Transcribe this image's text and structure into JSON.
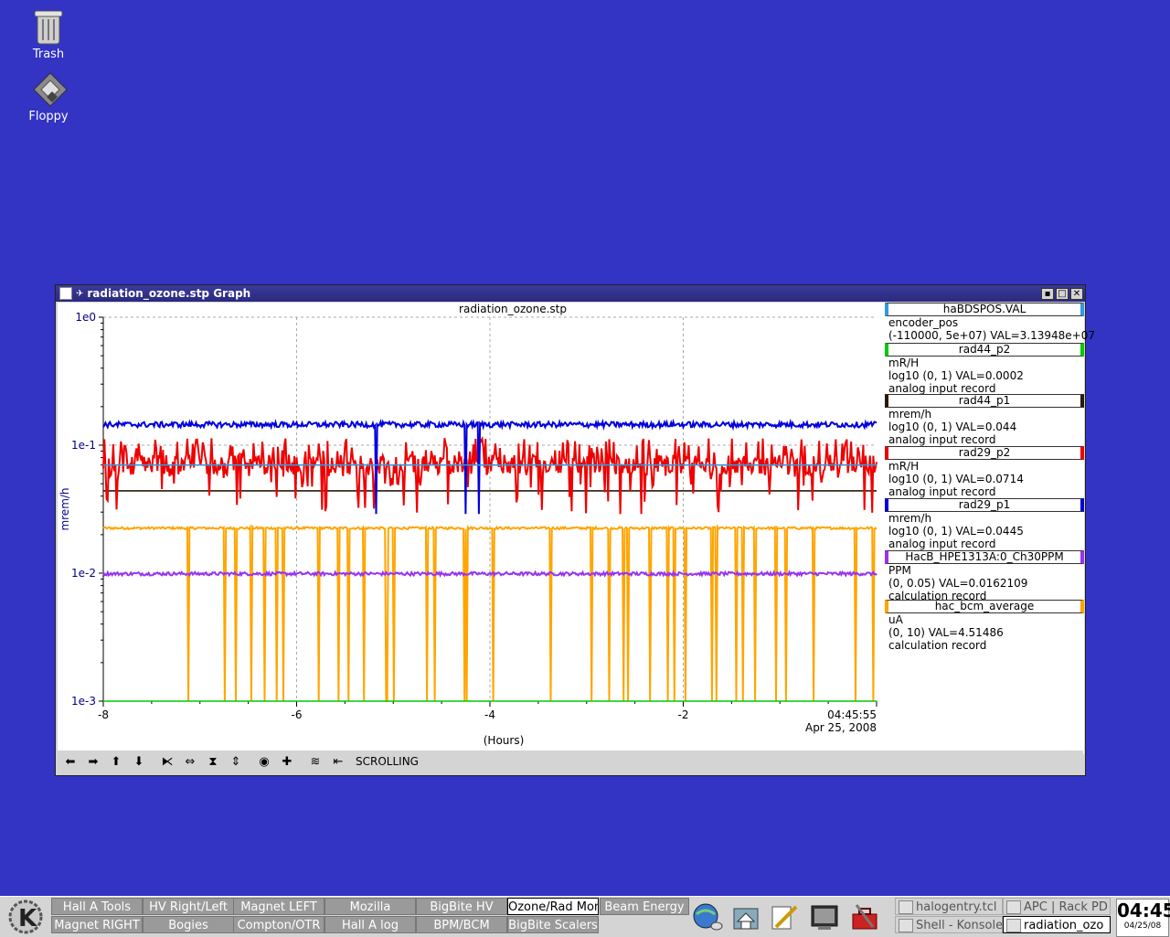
{
  "desktop": {
    "icons": [
      {
        "label": "Trash",
        "icon": "trash-icon"
      },
      {
        "label": "Floppy",
        "icon": "floppy-icon"
      }
    ]
  },
  "window": {
    "title": "radiation_ozone.stp Graph",
    "status": "SCROLLING"
  },
  "chart_data": {
    "type": "line",
    "title": "radiation_ozone.stp",
    "xlabel": "(Hours)",
    "ylabel": "mrem/h",
    "x_ticks": [
      "-8",
      "-6",
      "-4",
      "-2"
    ],
    "x_end_label": [
      "04:45:55",
      "Apr 25, 2008"
    ],
    "y_ticks": [
      "1e0",
      "1e-1",
      "1e-2",
      "1e-3"
    ],
    "y_scale": "log",
    "ylim": [
      0.001,
      1
    ],
    "xlim": [
      -8,
      0
    ],
    "grid": true,
    "series": [
      {
        "name": "haBDSPOS.VAL",
        "color": "#3399dd",
        "level": 0.07,
        "noise": 0.0,
        "dips": 0
      },
      {
        "name": "rad44_p2",
        "color": "#00cc00",
        "level": 0.001,
        "noise": 0.0,
        "dips": 0
      },
      {
        "name": "rad44_p1",
        "color": "#2a1a0a",
        "level": 0.044,
        "noise": 0.0,
        "dips": 0
      },
      {
        "name": "rad29_p2",
        "color": "#ee0000",
        "level": 0.0714,
        "noise": 0.18,
        "dips": 60
      },
      {
        "name": "rad29_p1",
        "color": "#0000dd",
        "level": 0.145,
        "noise": 0.05,
        "dips": 3
      },
      {
        "name": "HacB_HPE1313A:0_Ch30PPM",
        "color": "#9933ee",
        "level": 0.0099,
        "noise": 0.03,
        "dips": 0
      },
      {
        "name": "hac_bcm_average",
        "color": "#ffa500",
        "level": 0.0225,
        "noise": 0.02,
        "dips": 40
      }
    ]
  },
  "legend": [
    {
      "name": "haBDSPOS.VAL",
      "color": "#3399dd",
      "lines": [
        "encoder_pos",
        "(-110000, 5e+07) VAL=3.13948e+07"
      ]
    },
    {
      "name": "rad44_p2",
      "color": "#00cc00",
      "lines": [
        "mR/H",
        "log10 (0, 1) VAL=0.0002",
        "analog input record"
      ]
    },
    {
      "name": "rad44_p1",
      "color": "#2a1a0a",
      "lines": [
        "mrem/h",
        "log10 (0, 1) VAL=0.044",
        "analog input record"
      ]
    },
    {
      "name": "rad29_p2",
      "color": "#ee0000",
      "lines": [
        "mR/H",
        "log10 (0, 1) VAL=0.0714",
        "analog input record"
      ]
    },
    {
      "name": "rad29_p1",
      "color": "#0000dd",
      "lines": [
        "mrem/h",
        "log10 (0, 1) VAL=0.0445",
        "analog input record"
      ]
    },
    {
      "name": "HacB_HPE1313A:0_Ch30PPM",
      "color": "#9933ee",
      "lines": [
        "PPM",
        "(0, 0.05) VAL=0.0162109",
        "calculation record"
      ]
    },
    {
      "name": "hac_bcm_average",
      "color": "#ffa500",
      "lines": [
        "uA",
        "(0, 10) VAL=4.51486",
        "calculation record"
      ]
    }
  ],
  "taskbar": {
    "buttons_row1": [
      "Hall A Tools",
      "HV Right/Left",
      "Magnet LEFT",
      "Mozilla",
      "BigBite HV",
      "Ozone/Rad Mon",
      "Beam Energy"
    ],
    "buttons_row2": [
      "Magnet RIGHT",
      "Bogies",
      "Compton/OTR",
      "Hall A log",
      "BPM/BCM",
      "BigBite Scalers"
    ],
    "active_button": "Ozone/Rad Mon",
    "tasks": [
      "halogentry.tcl",
      "APC | Rack PD",
      "Shell - Konsole",
      "radiation_ozo"
    ],
    "active_task": "radiation_ozo",
    "clock_time": "04:45",
    "clock_date": "04/25/08"
  }
}
